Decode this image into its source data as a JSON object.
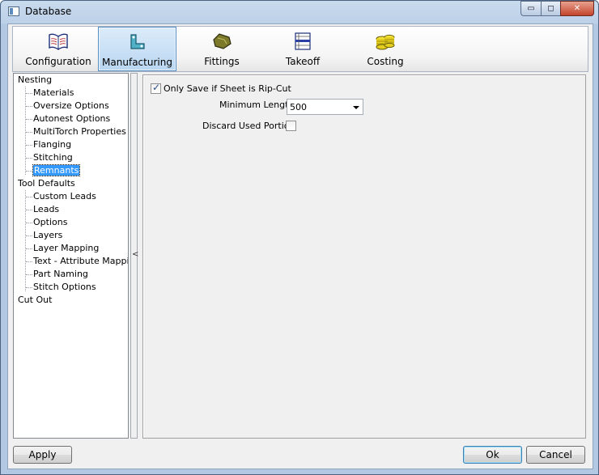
{
  "window": {
    "title": "Database"
  },
  "title_buttons": {
    "minimize": "▭",
    "maximize": "◻",
    "close": "✕"
  },
  "toolbar": [
    {
      "label": "Configuration",
      "icon": "book-icon",
      "active": false
    },
    {
      "label": "Manufacturing",
      "icon": "duct-part-icon",
      "active": true
    },
    {
      "label": "Fittings",
      "icon": "fitting-icon",
      "active": false
    },
    {
      "label": "Takeoff",
      "icon": "takeoff-icon",
      "active": false
    },
    {
      "label": "Costing",
      "icon": "coins-icon",
      "active": false
    }
  ],
  "tree": {
    "nesting": "Nesting",
    "nesting_children": [
      "Materials",
      "Oversize Options",
      "Autonest Options",
      "MultiTorch Properties",
      "Flanging",
      "Stitching",
      "Remnants"
    ],
    "tool_defaults": "Tool Defaults",
    "tool_children": [
      "Custom Leads",
      "Leads",
      "Options",
      "Layers",
      "Layer Mapping",
      "Text - Attribute Mapping",
      "Part Naming",
      "Stitch Options"
    ],
    "cut_out": "Cut Out",
    "selected": "Remnants"
  },
  "splitter": {
    "arrow": "<"
  },
  "panel": {
    "only_save_label": "Only Save if Sheet is Rip-Cut",
    "only_save_checked": true,
    "min_length_label": "Minimum Length",
    "min_length_value": "500",
    "discard_label": "Discard Used Portion",
    "discard_checked": false
  },
  "buttons": {
    "apply": "Apply",
    "ok": "Ok",
    "cancel": "Cancel"
  }
}
